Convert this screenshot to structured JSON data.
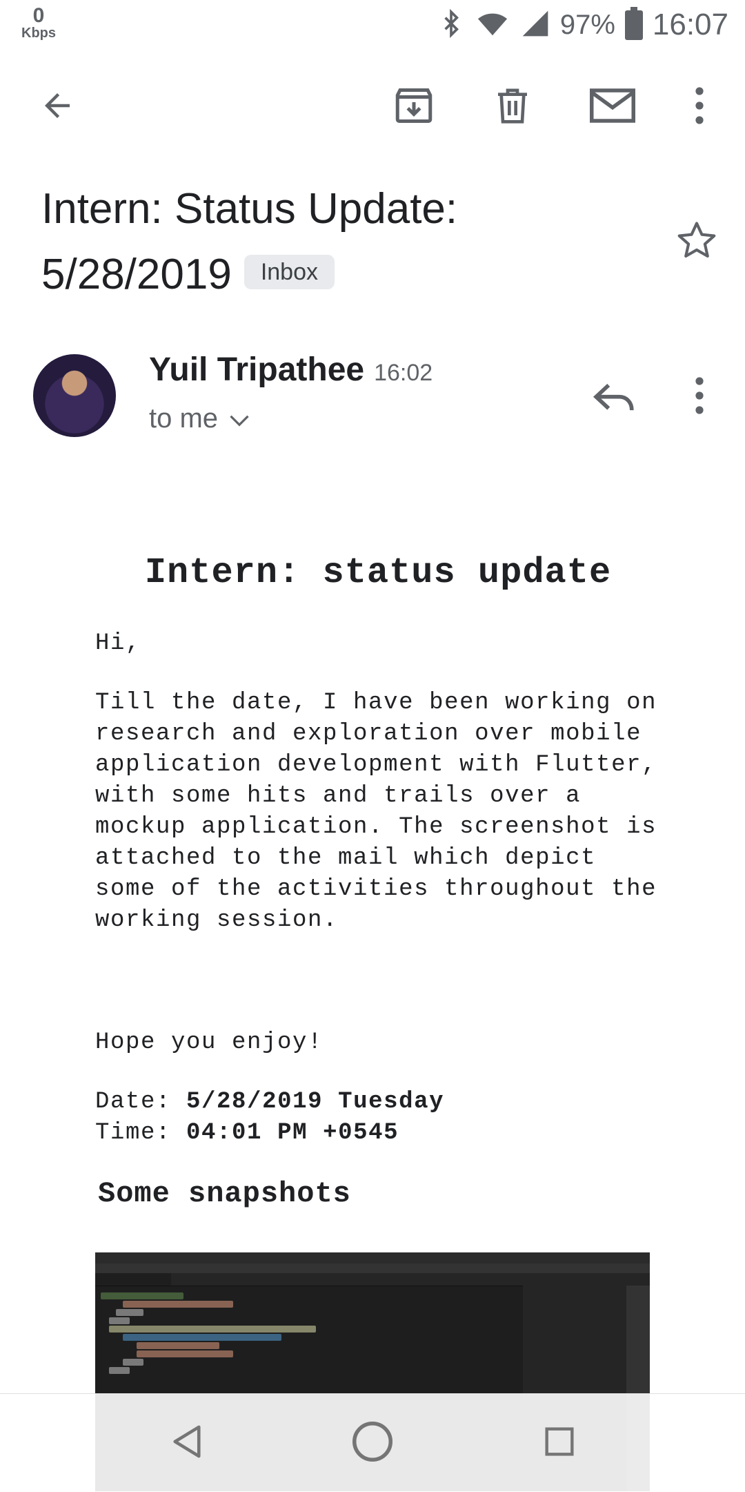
{
  "status_bar": {
    "net_speed_value": "0",
    "net_speed_unit": "Kbps",
    "battery_percent": "97%",
    "time": "16:07"
  },
  "toolbar": {
    "icons": [
      "back-arrow-icon",
      "archive-icon",
      "delete-icon",
      "mark-unread-icon",
      "more-vert-icon"
    ]
  },
  "email": {
    "subject_line1": "Intern: Status Update:",
    "subject_line2": "5/28/2019",
    "label": "Inbox",
    "sender": "Yuil Tripathee",
    "received_time": "16:02",
    "recipient": "to me",
    "body": {
      "title": "Intern: status update",
      "greeting": "Hi,",
      "paragraph": "Till the date, I have been working on research and exploration over mobile application development with Flutter, with some hits and trails over a mockup application. The screenshot is attached to the mail which depict some of the activities throughout the working session.",
      "closing": "Hope you enjoy!",
      "date_label": "Date:",
      "date_value": "5/28/2019 Tuesday",
      "time_label": "Time:",
      "time_value": "04:01 PM +0545",
      "snapshots_heading": "Some snapshots"
    }
  },
  "colors": {
    "icon_gray": "#5f6368",
    "text": "#202124",
    "chip_bg": "#e8eaed"
  }
}
